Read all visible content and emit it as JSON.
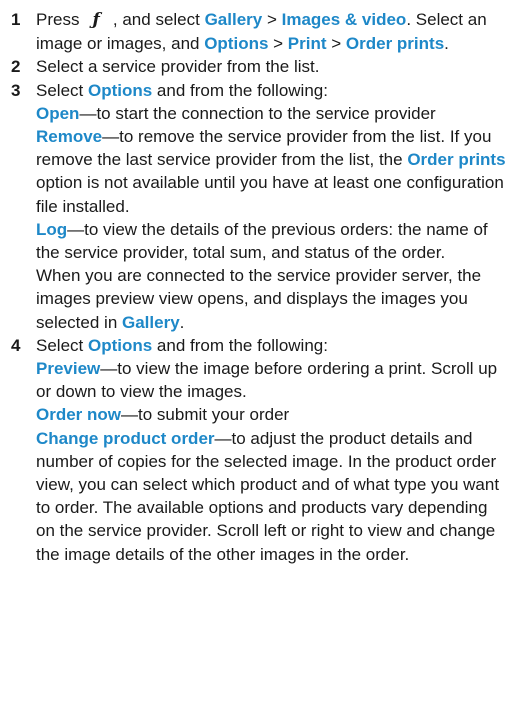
{
  "colors": {
    "highlight": "#1e88c8",
    "text": "#1a1a1a"
  },
  "icons": {
    "menu_key": "menu-key-icon"
  },
  "steps": [
    {
      "num": "1",
      "p1": {
        "t1": "Press ",
        "icon_glyph": "ƒ",
        "t2": " , and select ",
        "b1": "Gallery",
        "t3": " > ",
        "b2": "Images & video",
        "t4": ". Select an image or images, and ",
        "b3": "Options",
        "t5": " > ",
        "b4": "Print",
        "t6": " > ",
        "b5": "Order prints",
        "t7": "."
      }
    },
    {
      "num": "2",
      "p1": {
        "t1": "Select a service provider from the list."
      }
    },
    {
      "num": "3",
      "p1": {
        "t1": "Select ",
        "b1": "Options",
        "t2": " and from the following:"
      },
      "p2": {
        "b1": "Open",
        "t1": "—to start the connection to the service provider"
      },
      "p3": {
        "b1": "Remove",
        "t1": "—to remove the service provider from the list. If you remove the last service provider from the list, the ",
        "b2": "Order prints",
        "t2": " option is not available until you have at least one configuration file installed."
      },
      "p4": {
        "b1": "Log",
        "t1": "—to view the details of the previous orders: the name of the service provider, total sum, and status of the order."
      },
      "p5": {
        "t1": "When you are connected to the service provider server, the images preview view opens, and displays the images you selected in ",
        "b1": "Gallery",
        "t2": "."
      }
    },
    {
      "num": "4",
      "p1": {
        "t1": "Select ",
        "b1": "Options",
        "t2": " and from the following:"
      },
      "p2": {
        "b1": "Preview",
        "t1": "—to view the image before ordering a print. Scroll up or down to view the images."
      },
      "p3": {
        "b1": "Order now",
        "t1": "—to submit your order"
      },
      "p4": {
        "b1": "Change product order",
        "t1": "—to adjust the product details and number of copies for the selected image. In the product order view, you can select which product and of what type you want to order. The available options and products vary depending on the service provider. Scroll left or right to view and change the image details of the other images in the order."
      }
    }
  ]
}
